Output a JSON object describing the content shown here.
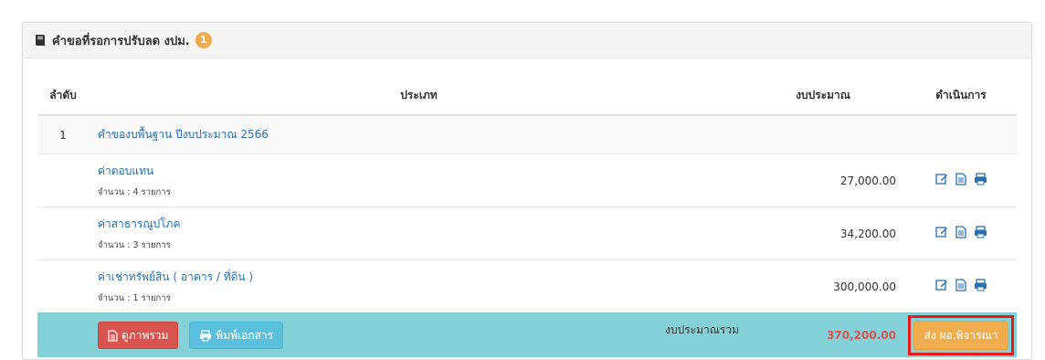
{
  "panel": {
    "title": "คำขอที่รอการปรับลด งปม.",
    "badge": "1"
  },
  "table": {
    "headers": {
      "no": "ลำดับ",
      "type": "ประเภท",
      "budget": "งบประมาณ",
      "action": "ดำเนินการ"
    },
    "main": {
      "no": "1",
      "title": "คำของบพื้นฐาน ปีงบประมาณ 2566"
    },
    "items": [
      {
        "name": "ค่าตอบแทน",
        "count": "จำนวน : 4 รายการ",
        "amount": "27,000.00"
      },
      {
        "name": "ค่าสาธารณูปโภค",
        "count": "จำนวน : 3 รายการ",
        "amount": "34,200.00"
      },
      {
        "name": "ค่าเช่าทรัพย์สิน ( อาคาร / ที่ดิน )",
        "count": "จำนวน : 1 รายการ",
        "amount": "300,000.00"
      }
    ],
    "total": {
      "overview_button": "ดูภาพรวม",
      "print_button": "พิมพ์เอกสาร",
      "label": "งบประมาณรวม",
      "amount": "370,200.00",
      "submit_button": "ส่ง ผอ.พิจารณา"
    }
  },
  "colors": {
    "accent": "#2a6fb0",
    "danger": "#d9534f",
    "info": "#5bc0de",
    "warning": "#f0ad4e",
    "total_row": "#85d1d8"
  },
  "icons": [
    "book-icon",
    "edit-icon",
    "document-icon",
    "print-icon"
  ]
}
